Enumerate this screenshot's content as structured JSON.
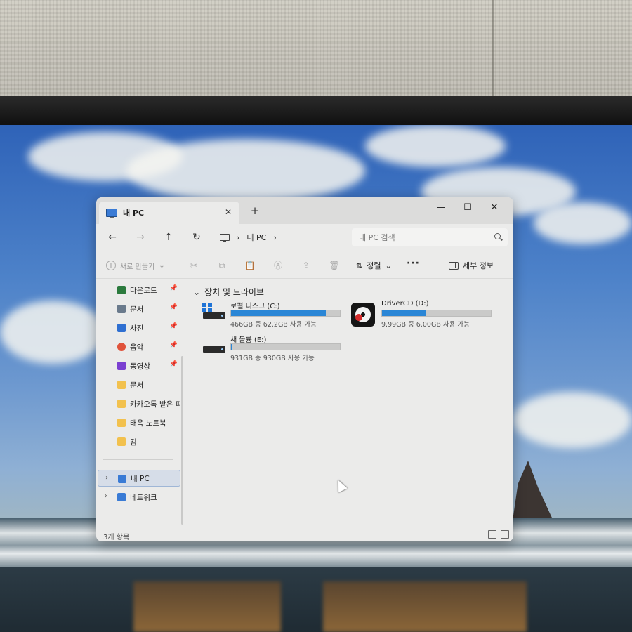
{
  "window": {
    "tab_title": "내 PC",
    "tab_close_glyph": "✕",
    "new_tab_glyph": "+",
    "minimize_glyph": "—",
    "maximize_glyph": "☐",
    "close_glyph": "✕"
  },
  "nav": {
    "back_glyph": "←",
    "forward_glyph": "→",
    "up_glyph": "↑",
    "refresh_glyph": "↻",
    "address": {
      "separator": "›",
      "location": "내 PC"
    },
    "search_placeholder": "내 PC 검색"
  },
  "toolbar": {
    "new_label": "새로 만들기",
    "new_glyph": "+",
    "dropdown_glyph": "⌄",
    "cut_glyph": "✂",
    "copy_glyph": "⧉",
    "paste_glyph": "📋",
    "rename_glyph": "Ⓐ",
    "share_glyph": "⇪",
    "delete_glyph": "🗑",
    "sort_label": "정렬",
    "sort_glyph": "⇅",
    "more_glyph": "···",
    "details_label": "세부 정보"
  },
  "sidebar": {
    "items": [
      {
        "label": "다운로드",
        "icon": "download-icon",
        "color": "#2b7a3d",
        "pinned": true
      },
      {
        "label": "문서",
        "icon": "document-icon",
        "color": "#6a7a8c",
        "pinned": true
      },
      {
        "label": "사진",
        "icon": "picture-icon",
        "color": "#2f6fd1",
        "pinned": true
      },
      {
        "label": "음악",
        "icon": "music-icon",
        "color": "#e0533b",
        "pinned": true
      },
      {
        "label": "동영상",
        "icon": "video-icon",
        "color": "#7a3fd1",
        "pinned": true
      },
      {
        "label": "문서",
        "icon": "folder-icon",
        "color": "#f2c14e",
        "pinned": false
      },
      {
        "label": "카카오톡 받은 파일",
        "icon": "folder-icon",
        "color": "#f2c14e",
        "pinned": false
      },
      {
        "label": "태욱 노트북",
        "icon": "folder-icon",
        "color": "#f2c14e",
        "pinned": false
      },
      {
        "label": "김",
        "icon": "folder-icon",
        "color": "#f2c14e",
        "pinned": false
      }
    ],
    "pin_glyph": "📌",
    "chevron_glyph": "›",
    "this_pc": {
      "label": "내 PC",
      "icon": "monitor-icon",
      "color": "#3a7bd5"
    },
    "network": {
      "label": "네트워크",
      "icon": "network-icon",
      "color": "#3a7bd5"
    }
  },
  "content": {
    "group_title": "장치 및 드라이브",
    "group_chevron": "⌄",
    "drives": [
      {
        "name": "로컬 디스크 (C:)",
        "size_text": "466GB 중 62.2GB 사용 가능",
        "used_fraction": 0.87,
        "icon": "windows-drive-icon"
      },
      {
        "name": "DriverCD (D:)",
        "size_text": "9.99GB 중 6.00GB 사용 가능",
        "used_fraction": 0.4,
        "icon": "drivercd-icon"
      },
      {
        "name": "새 볼륨 (E:)",
        "size_text": "931GB 중 930GB 사용 가능",
        "used_fraction": 0.001,
        "icon": "hard-drive-icon"
      }
    ]
  },
  "status": {
    "item_count": "3개 항목"
  },
  "colors": {
    "accent": "#2a86d6",
    "selection": "#d6dde8"
  }
}
